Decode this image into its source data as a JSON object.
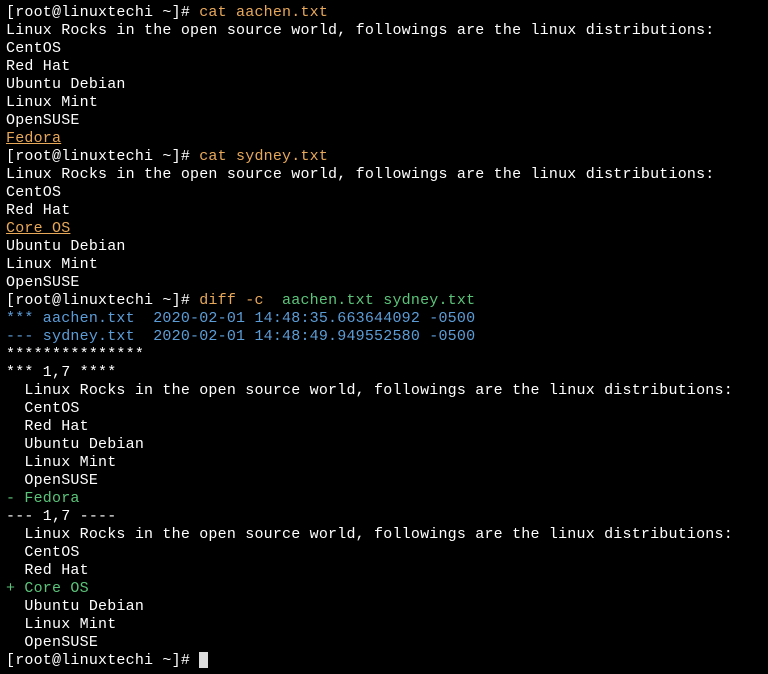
{
  "prompt": "[root@linuxtechi ~]# ",
  "commands": {
    "cat_aachen": "cat aachen.txt",
    "cat_sydney": "cat sydney.txt",
    "diff": {
      "cmd": "diff -c",
      "args": "  aachen.txt sydney.txt"
    }
  },
  "file_body_line": "Linux Rocks in the open source world, followings are the linux distributions:",
  "aachen": {
    "lines": [
      "CentOS",
      "Red Hat",
      "Ubuntu Debian",
      "Linux Mint",
      "OpenSUSE"
    ],
    "last_line": "Fedora"
  },
  "sydney": {
    "lines": [
      "CentOS",
      "Red Hat"
    ],
    "inserted": "Core OS",
    "tail": [
      "Ubuntu Debian",
      "Linux Mint",
      "OpenSUSE"
    ]
  },
  "diff_header": {
    "old": "*** aachen.txt  2020-02-01 14:48:35.663644092 -0500",
    "new": "--- sydney.txt  2020-02-01 14:48:49.949552580 -0500"
  },
  "stars": "***************",
  "old_range": "*** 1,7 ****",
  "new_range": "--- 1,7 ----",
  "context_block1": [
    "  Linux Rocks in the open source world, followings are the linux distributions:",
    "  CentOS",
    "  Red Hat",
    "  Ubuntu Debian",
    "  Linux Mint",
    "  OpenSUSE"
  ],
  "removed": "- Fedora",
  "context_block2": [
    "  Linux Rocks in the open source world, followings are the linux distributions:",
    "  CentOS",
    "  Red Hat"
  ],
  "added": "+ Core OS",
  "context_block3": [
    "  Ubuntu Debian",
    "  Linux Mint",
    "  OpenSUSE"
  ]
}
